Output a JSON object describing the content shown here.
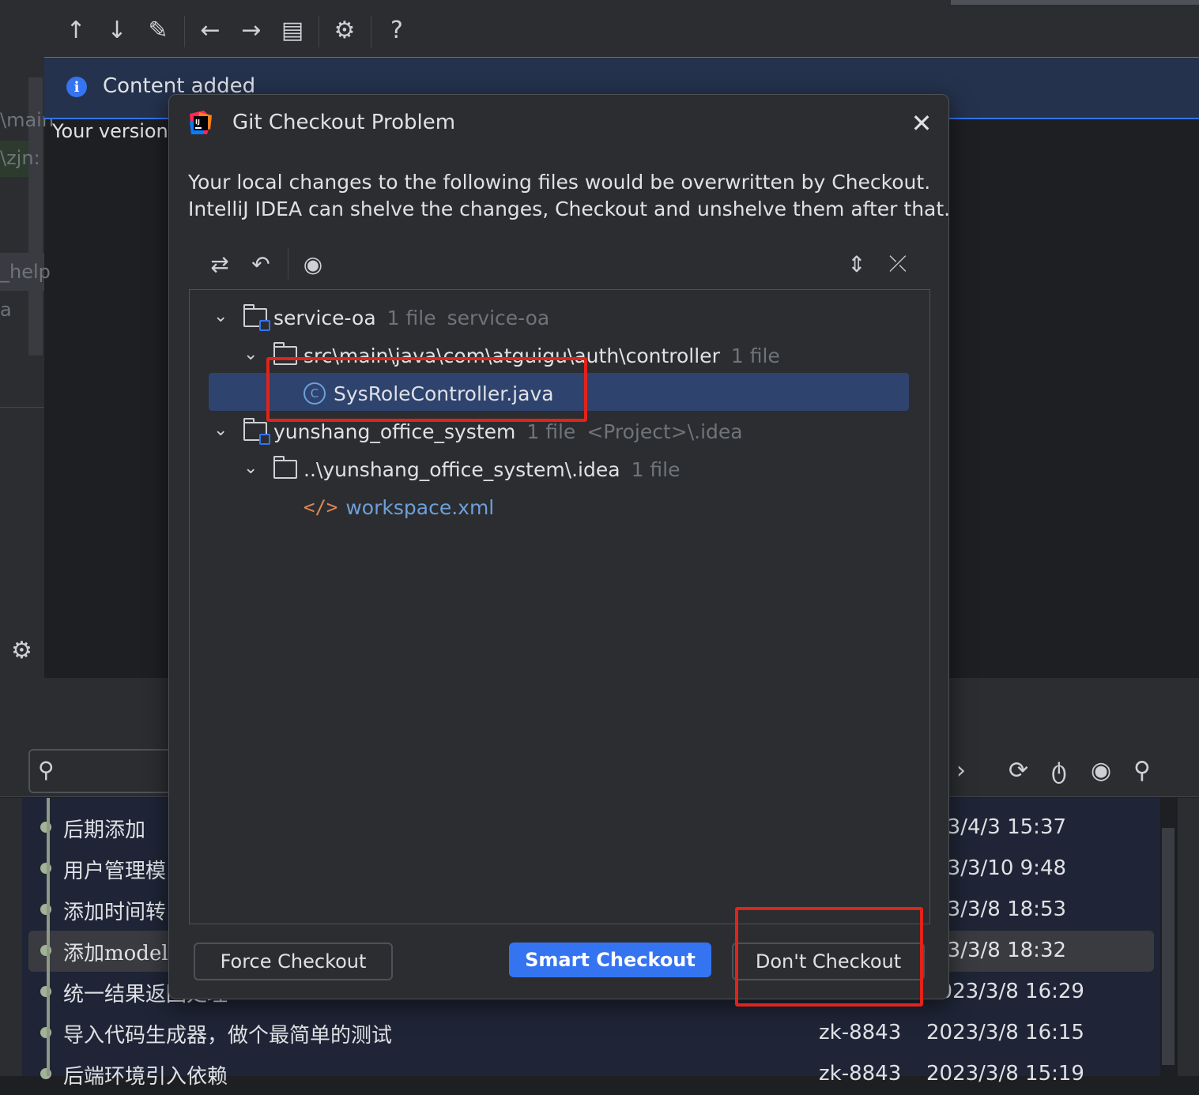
{
  "toolbar": {
    "icons": [
      "arrow-up-icon",
      "arrow-down-icon",
      "pencil-icon",
      "arrow-left-icon",
      "arrow-right-icon",
      "document-icon",
      "gear-icon",
      "help-icon"
    ]
  },
  "left_panel": {
    "fragments": [
      "\\main",
      "\\zjn:",
      "_help",
      "a"
    ]
  },
  "banner": {
    "text": "Content added",
    "subtext": "Your version"
  },
  "dialog": {
    "title": "Git Checkout Problem",
    "message_line1": "Your local changes to the following files would be overwritten by Checkout.",
    "message_line2": "IntelliJ IDEA can shelve the changes, Checkout and unshelve them after that.",
    "tree": [
      {
        "name": "service-oa",
        "count": "1 file",
        "extra": "service-oa"
      },
      {
        "name": "src\\main\\java\\com\\atguigu\\auth\\controller",
        "count": "1 file"
      },
      {
        "name": "SysRoleController.java"
      },
      {
        "name": "yunshang_office_system",
        "count": "1 file",
        "extra": "<Project>\\.idea"
      },
      {
        "name": "..\\yunshang_office_system\\.idea",
        "count": "1 file"
      },
      {
        "name": "workspace.xml"
      }
    ],
    "buttons": {
      "force": "Force Checkout",
      "smart": "Smart Checkout",
      "dont": "Don't Checkout"
    }
  },
  "log": {
    "rows": [
      {
        "message": "后期添加",
        "author": "",
        "date": ")23/4/3 15:37"
      },
      {
        "message": "用户管理模",
        "author": "",
        "date": ")23/3/10 9:48"
      },
      {
        "message": "添加时间转",
        "author": "",
        "date": ")23/3/8 18:53"
      },
      {
        "message": "添加model",
        "author": "",
        "date": ")23/3/8 18:32"
      },
      {
        "message": "统一结果返回处理",
        "author": "zk-8843",
        "date": "2023/3/8 16:29"
      },
      {
        "message": "导入代码生成器，做个最简单的测试",
        "author": "zk-8843",
        "date": "2023/3/8 16:15"
      },
      {
        "message": "后端环境引入依赖",
        "author": "zk-8843",
        "date": "2023/3/8 15:19"
      }
    ]
  },
  "colors": {
    "accent": "#3574f0",
    "highlight_box": "#e2231a",
    "selection": "#2e436e"
  }
}
